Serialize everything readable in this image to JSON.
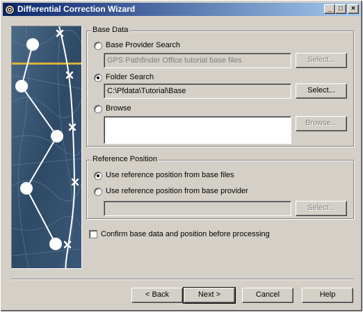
{
  "window": {
    "title": "Differential Correction Wizard",
    "controls": {
      "minimize": "_",
      "maximize": "□",
      "close": "×"
    }
  },
  "base_data": {
    "group_label": "Base Data",
    "provider_search": {
      "label": "Base Provider Search",
      "selected": false,
      "value": "GPS Pathfinder Office tutorial base files",
      "button": "Select..."
    },
    "folder_search": {
      "label": "Folder Search",
      "selected": true,
      "value": "C:\\Pfdata\\Tutorial\\Base",
      "button": "Select..."
    },
    "browse": {
      "label": "Browse",
      "selected": false,
      "value": "",
      "button": "Browse..."
    }
  },
  "reference_position": {
    "group_label": "Reference Position",
    "from_base_files": {
      "label": "Use reference position from base files",
      "selected": true
    },
    "from_base_provider": {
      "label": "Use reference position from base provider",
      "selected": false,
      "value": "",
      "button": "Select..."
    }
  },
  "confirm": {
    "label": "Confirm base data and position before processing",
    "checked": false
  },
  "footer": {
    "back": "< Back",
    "next": "Next  >",
    "cancel": "Cancel",
    "help": "Help"
  },
  "colors": {
    "titlebar_start": "#0a246a",
    "titlebar_end": "#a6caf0",
    "map_background": "#2e4a66",
    "map_accent": "#d8b43c"
  }
}
